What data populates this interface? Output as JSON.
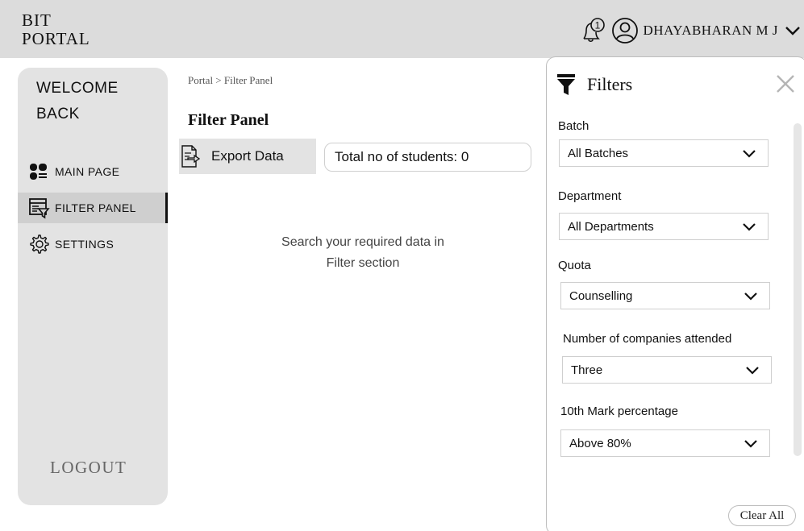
{
  "header": {
    "brand_line1": "BIT",
    "brand_line2": "PORTAL",
    "notification_count": "1",
    "username": "DHAYABHARAN M J"
  },
  "sidebar": {
    "welcome_line1": "WELCOME",
    "welcome_line2": "BACK",
    "items": [
      {
        "label": "MAIN PAGE",
        "icon": "dashboard-icon"
      },
      {
        "label": "FILTER PANEL",
        "icon": "filter-panel-icon",
        "active": true
      },
      {
        "label": "SETTINGS",
        "icon": "gear-icon"
      }
    ],
    "logout_label": "LOGOUT"
  },
  "main": {
    "breadcrumb": "Portal > Filter Panel",
    "title": "Filter Panel",
    "export_label": "Export Data",
    "total_label": "Total no of students: 0",
    "empty_line1": "Search your required data in",
    "empty_line2": "Filter section"
  },
  "filters": {
    "title": "Filters",
    "clear_all_label": "Clear All",
    "fields": [
      {
        "label": "Batch",
        "value": "All Batches"
      },
      {
        "label": "Department",
        "value": "All Departments"
      },
      {
        "label": "Quota",
        "value": "Counselling"
      },
      {
        "label": "Number of companies attended",
        "value": "Three"
      },
      {
        "label": "10th Mark percentage",
        "value": "Above 80%"
      }
    ]
  },
  "colors": {
    "topbar_bg": "#dcdcdc",
    "sidebar_bg": "#e3e3e3",
    "active_item_bg": "#cfcfcf"
  }
}
